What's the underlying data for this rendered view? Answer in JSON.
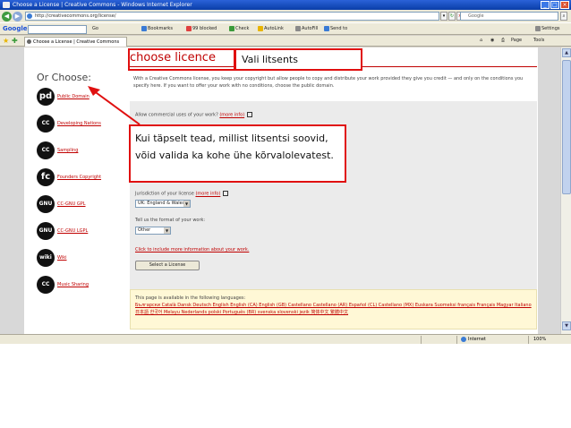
{
  "browser": {
    "title": "Choose a License | Creative Commons - Windows Internet Explorer",
    "url": "http://creativecommons.org/license/",
    "search_placeholder": "Google",
    "google_search_text": "",
    "google_toolbar": {
      "go_label": "Go",
      "bookmarks_label": "Bookmarks",
      "blocked_label": "99 blocked",
      "check_label": "Check",
      "autolink_label": "AutoLink",
      "autofill_label": "AutoFill",
      "sendto_label": "Send to",
      "settings_label": "Settings"
    },
    "tab_title": "Choose a License | Creative Commons",
    "tools": {
      "page_label": "Page",
      "tools_label": "Tools"
    },
    "status": {
      "zone": "Internet",
      "zoom": "100%"
    }
  },
  "page": {
    "heading": "choose licence",
    "intro_text": "With a Creative Commons license, you keep your copyright but allow people to copy and distribute your work provided they give you credit — and only on the conditions you specify here. If you want to offer your work with no conditions, choose the public domain.",
    "left_nav": {
      "title": "Or Choose:",
      "items": [
        {
          "badge": "pd",
          "label": "Public Domain"
        },
        {
          "badge": "CC",
          "label": "Developing Nations"
        },
        {
          "badge": "CC",
          "label": "Sampling"
        },
        {
          "badge": "fc",
          "label": "Founders Copyright"
        },
        {
          "badge": "GNU",
          "label": "CC-GNU GPL"
        },
        {
          "badge": "GNU",
          "label": "CC-GNU LGPL"
        },
        {
          "badge": "wiki",
          "label": "Wiki"
        },
        {
          "badge": "CC",
          "label": "Music Sharing"
        }
      ]
    },
    "form": {
      "q_commercial": "Allow commercial uses of your work?",
      "q_commercial_more": "(more info)",
      "q_jurisdiction": "Jurisdiction of your license",
      "q_jurisdiction_more": "(more info)",
      "jurisdiction_value": "UK: England & Wales",
      "q_format": "Tell us the format of your work:",
      "format_value": "Other",
      "locale_link": "Click to include more information about your work.",
      "submit_label": "Select a License"
    },
    "languages": {
      "intro": "This page is available in the following languages:",
      "list": "Български Català Dansk Deutsch English English (CA) English (GB) Castellano Castellano (AR) Español (CL) Castellano (MX) Euskara Suomeksi français Français Magyar Italiano 日本語 한국어 Melayu Nederlands polski Português (BR) svenska slovenski jezik 简体中文 繁體中文"
    }
  },
  "annotations": {
    "top_callout": "Vali litsents",
    "main_callout": "Kui täpselt tead, millist litsentsi soovid, võid valida ka kohe ühe kõrvalolevatest."
  },
  "colors": {
    "accent": "#c00000",
    "annotation_red": "#e01010",
    "form_bg": "#ebebeb",
    "language_box_bg": "#fff8d6"
  }
}
